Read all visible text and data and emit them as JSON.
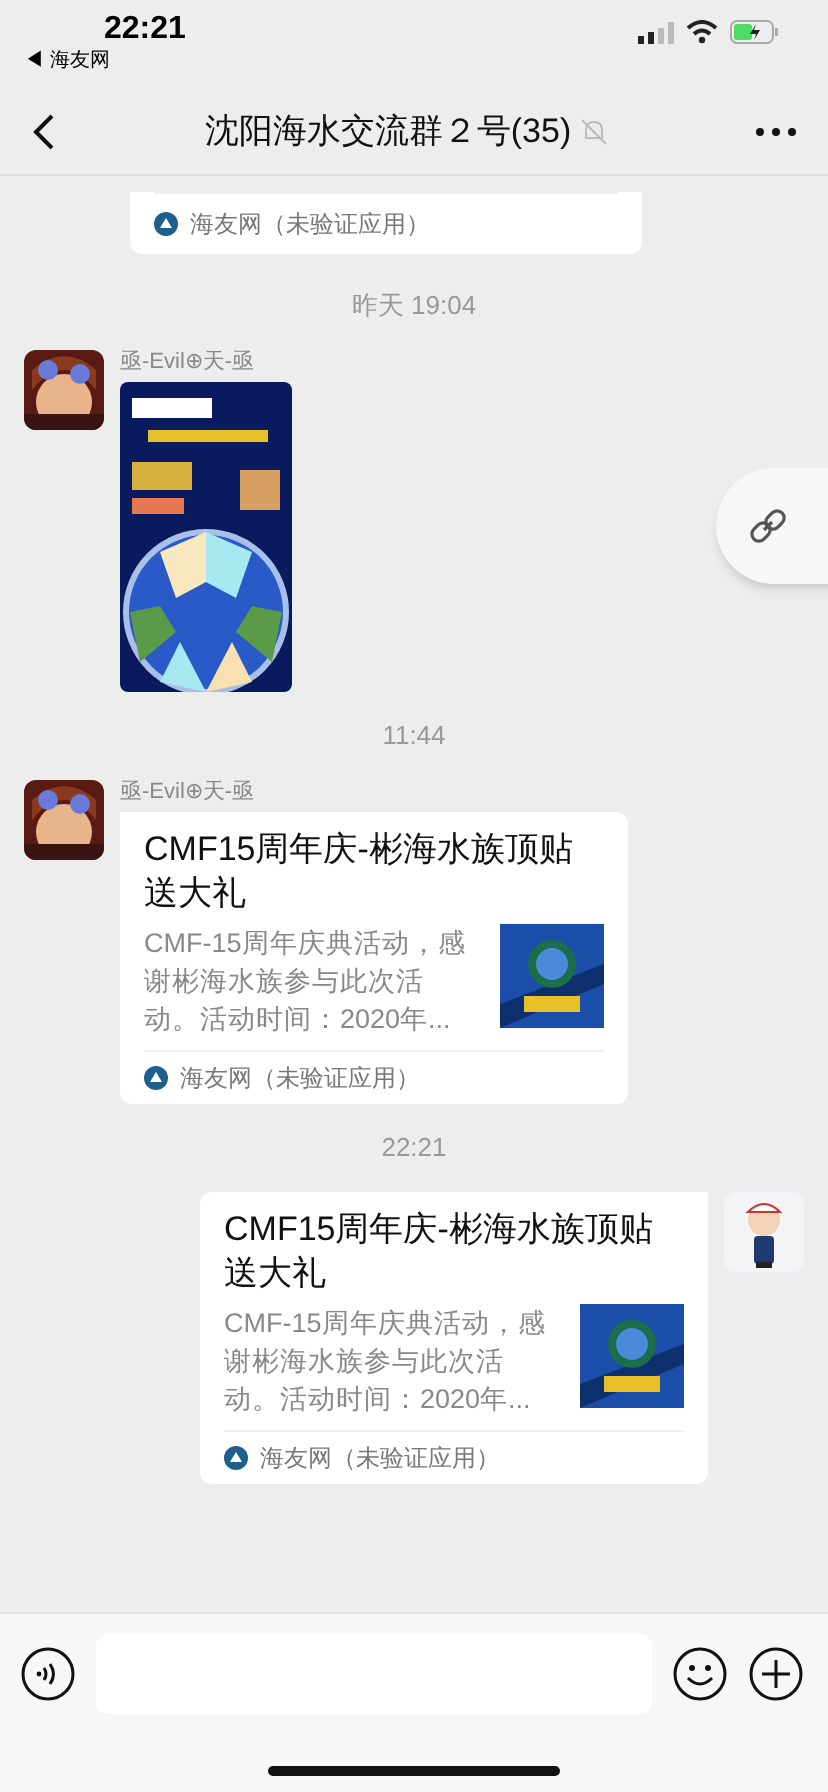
{
  "status_bar": {
    "time": "22:21",
    "back_app": "◀ 海友网"
  },
  "nav": {
    "title": "沈阳海水交流群２号(35)",
    "muted": true
  },
  "messages": [
    {
      "kind": "card_tail",
      "source": "海友网（未验证应用）"
    },
    {
      "kind": "time",
      "text": "昨天 19:04"
    },
    {
      "outgoing": false,
      "sender": "亟-Evil⊕天-亟"
    },
    {
      "kind": "time",
      "text": "11:44"
    },
    {
      "kind": "card",
      "outgoing": false,
      "sender": "亟-Evil⊕天-亟",
      "title": "CMF15周年庆-彬海水族顶贴送大礼",
      "desc": "CMF-15周年庆典活动，感谢彬海水族参与此次活动。活动时间：2020年...",
      "source": "海友网（未验证应用）"
    },
    {
      "kind": "time",
      "text": "22:21"
    },
    {
      "kind": "card",
      "outgoing": true,
      "title": "CMF15周年庆-彬海水族顶贴送大礼",
      "desc": "CMF-15周年庆典活动，感谢彬海水族参与此次活动。活动时间：2020年...",
      "source": "海友网（未验证应用）"
    }
  ]
}
